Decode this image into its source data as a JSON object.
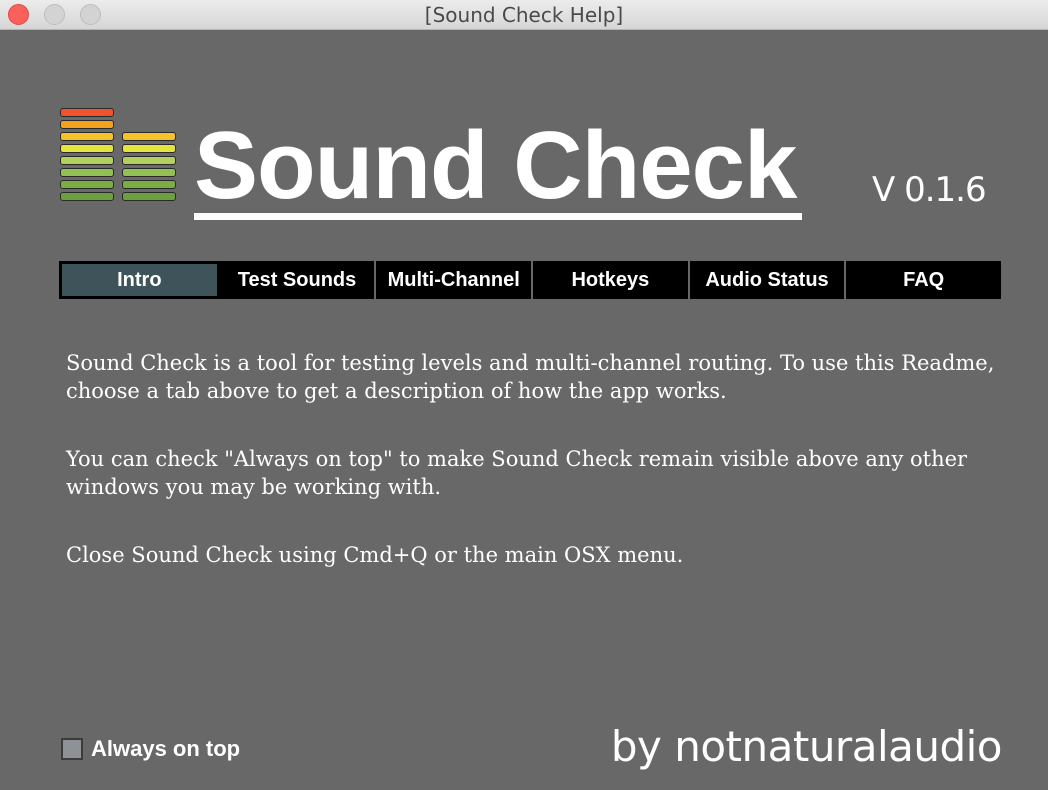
{
  "window": {
    "title": "[Sound Check Help]"
  },
  "header": {
    "app_title": "Sound Check",
    "version": "V 0.1.6"
  },
  "logo": {
    "left_meter_colors": [
      "#f0522e",
      "#f4a21d",
      "#f6c22a",
      "#e5e43d",
      "#b4d05c",
      "#92c053",
      "#7aae45",
      "#6c9f3d"
    ],
    "right_meter_colors": [
      "#f6c22a",
      "#e5e43d",
      "#b4d05c",
      "#92c053",
      "#7aae45",
      "#6c9f3d"
    ]
  },
  "tabs": [
    {
      "label": "Intro",
      "active": true
    },
    {
      "label": "Test Sounds",
      "active": false
    },
    {
      "label": "Multi-Channel",
      "active": false
    },
    {
      "label": "Hotkeys",
      "active": false
    },
    {
      "label": "Audio Status",
      "active": false
    },
    {
      "label": "FAQ",
      "active": false
    }
  ],
  "content": {
    "paragraphs": [
      "Sound Check is a tool for testing levels and multi-channel routing. To use this Readme, choose a tab above to get a description of how the app works.",
      "You can check \"Always on top\" to make Sound Check remain visible above any other windows you may be working with.",
      "Close Sound Check using Cmd+Q or the main OSX menu."
    ]
  },
  "footer": {
    "always_on_top_label": "Always on top",
    "always_on_top_checked": false,
    "credit": "by notnaturalaudio"
  },
  "colors": {
    "background": "#686868",
    "active_tab": "#3e535a",
    "tab_bg": "#000000",
    "text": "#ffffff"
  }
}
